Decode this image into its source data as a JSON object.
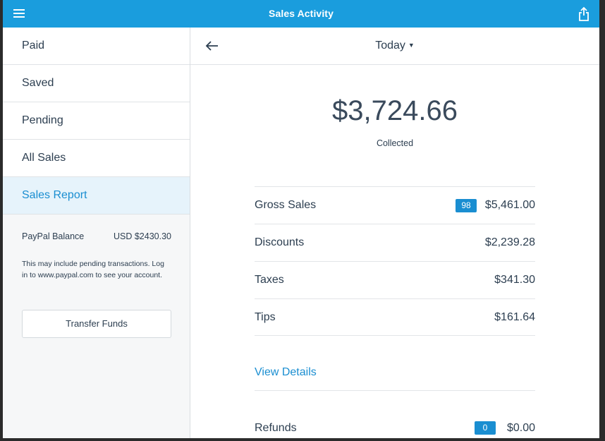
{
  "header": {
    "title": "Sales Activity"
  },
  "sidebar": {
    "items": [
      {
        "label": "Paid"
      },
      {
        "label": "Saved"
      },
      {
        "label": "Pending"
      },
      {
        "label": "All Sales"
      },
      {
        "label": "Sales Report"
      }
    ],
    "active_item": "Sales Report",
    "balance_label": "PayPal Balance",
    "balance_value": "USD $2430.30",
    "note": "This may include pending transactions. Log in to www.paypal.com to see your account.",
    "transfer_label": "Transfer Funds"
  },
  "main": {
    "period": "Today",
    "collected_amount": "$3,724.66",
    "collected_label": "Collected",
    "rows": [
      {
        "label": "Gross Sales",
        "badge": "98",
        "value": "$5,461.00"
      },
      {
        "label": "Discounts",
        "value": "$2,239.28"
      },
      {
        "label": "Taxes",
        "value": "$341.30"
      },
      {
        "label": "Tips",
        "value": "$161.64"
      }
    ],
    "view_details": "View Details",
    "refunds": {
      "label": "Refunds",
      "badge": "0",
      "value": "$0.00"
    }
  },
  "colors": {
    "accent": "#1a9ddd",
    "link": "#1a8ed1",
    "active_bg": "#e6f3fb"
  },
  "icons": {
    "menu": "hamburger-menu-icon",
    "share": "share-icon",
    "back": "back-arrow-icon",
    "caret": "caret-down-icon"
  }
}
